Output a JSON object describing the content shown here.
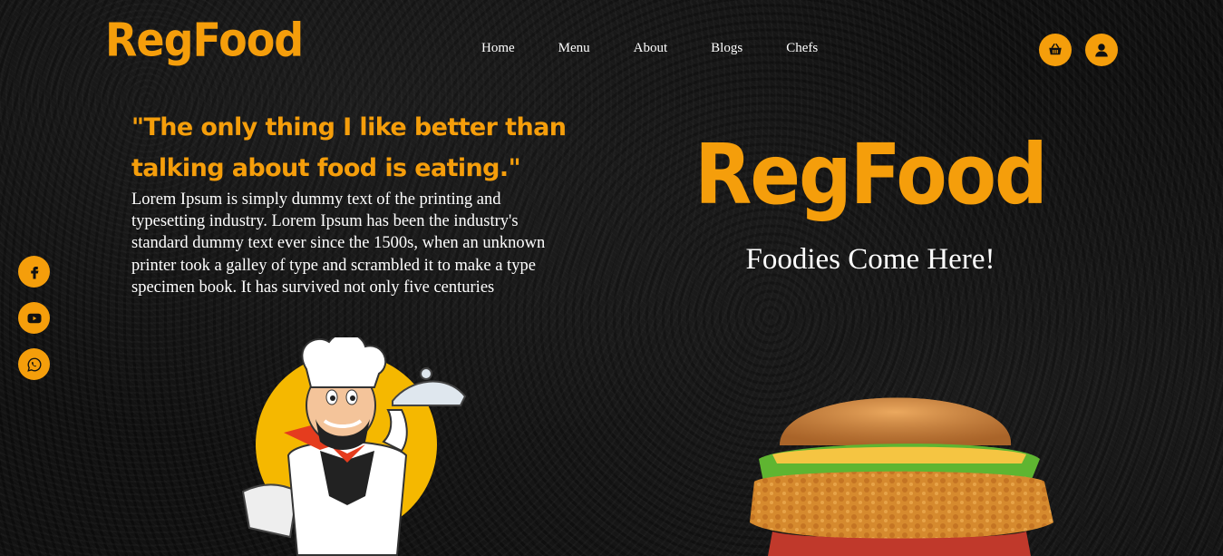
{
  "header": {
    "logo": "RegFood",
    "nav": [
      "Home",
      "Menu",
      "About",
      "Blogs",
      "Chefs"
    ],
    "icons": [
      "basket-icon",
      "user-icon"
    ]
  },
  "intro": {
    "quote": "\"The only thing I like better than talking about food is eating.\"",
    "body": "Lorem Ipsum is simply dummy text of the printing and typesetting industry. Lorem Ipsum has been the industry's standard dummy text ever since the 1500s, when an unknown printer took a galley of type and scrambled it to make a type specimen book. It has survived not only five centuries"
  },
  "social": [
    "facebook-icon",
    "youtube-icon",
    "whatsapp-icon"
  ],
  "hero": {
    "title": "RegFood",
    "subtitle": "Foodies Come Here!"
  },
  "colors": {
    "accent": "#f59e0b",
    "background": "#121212",
    "text": "#ffffff"
  }
}
